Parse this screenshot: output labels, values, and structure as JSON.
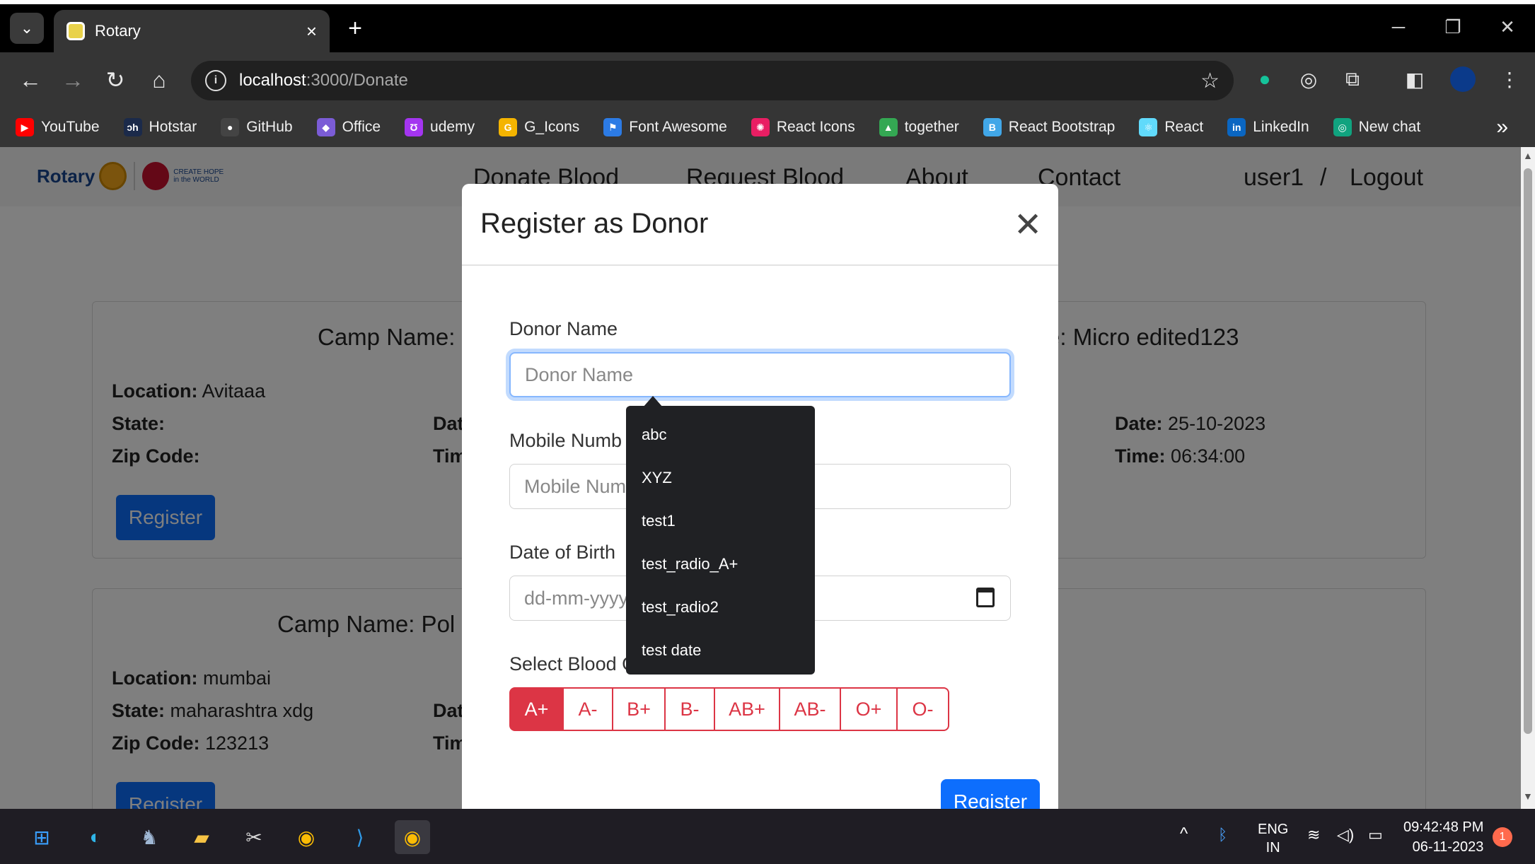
{
  "browser": {
    "tab_title": "Rotary",
    "url_host": "localhost",
    "url_path": ":3000/Donate",
    "bookmarks": [
      {
        "label": "YouTube",
        "color": "#ff0000",
        "glyph": "▶"
      },
      {
        "label": "Hotstar",
        "color": "#1b2a4a",
        "glyph": "ɔh"
      },
      {
        "label": "GitHub",
        "color": "#444444",
        "glyph": "●"
      },
      {
        "label": "Office",
        "color": "#7b5cd6",
        "glyph": "◆"
      },
      {
        "label": "udemy",
        "color": "#a435f0",
        "glyph": "Ʊ"
      },
      {
        "label": "G_Icons",
        "color": "#f4b400",
        "glyph": "G"
      },
      {
        "label": "Font Awesome",
        "color": "#2c7be5",
        "glyph": "⚑"
      },
      {
        "label": "React Icons",
        "color": "#e91e63",
        "glyph": "✺"
      },
      {
        "label": "together",
        "color": "#34a853",
        "glyph": "▲"
      },
      {
        "label": "React Bootstrap",
        "color": "#41a7e8",
        "glyph": "B"
      },
      {
        "label": "React",
        "color": "#61dafb",
        "glyph": "⚛"
      },
      {
        "label": "LinkedIn",
        "color": "#0a66c2",
        "glyph": "in"
      },
      {
        "label": "New chat",
        "color": "#10a37f",
        "glyph": "◎"
      }
    ],
    "more_bookmarks": "»"
  },
  "navbar": {
    "logo_text": "Rotary",
    "logo_tagline": "CREATE HOPE in the WORLD",
    "links": [
      "Donate Blood",
      "Request Blood",
      "About",
      "Contact"
    ],
    "user": "user1",
    "separator": "/",
    "logout": "Logout"
  },
  "camps": [
    {
      "title_left": "Camp Name:",
      "title_right": "e: Micro edited123",
      "location_label": "Location:",
      "location": "Avitaaa",
      "state_label": "State:",
      "state": "",
      "zip_label": "Zip Code:",
      "zip": "",
      "date_left_label": "Dat",
      "time_left_label": "Tim",
      "date_label": "Date:",
      "date": "25-10-2023",
      "time_label": "Time:",
      "time": "06:34:00",
      "register": "Register"
    },
    {
      "title_left": "Camp Name: Pol",
      "location_label": "Location:",
      "location": "mumbai",
      "state_label": "State:",
      "state": "maharashtra xdg",
      "zip_label": "Zip Code:",
      "zip": "123213",
      "date_left_label": "Dat",
      "time_left_label": "Tim",
      "register": "Register"
    }
  ],
  "modal": {
    "title": "Register as Donor",
    "close": "✕",
    "donor_name_label": "Donor Name",
    "donor_name_placeholder": "Donor Name",
    "mobile_label": "Mobile Numb",
    "mobile_placeholder": "Mobile Num",
    "dob_label": "Date of Birth",
    "dob_placeholder": "dd-mm-yyyy",
    "blood_label": "Select Blood G",
    "blood_groups": [
      "A+",
      "A-",
      "B+",
      "B-",
      "AB+",
      "AB-",
      "O+",
      "O-"
    ],
    "selected_blood_group": "A+",
    "register": "Register"
  },
  "autocomplete": [
    "abc",
    "XYZ",
    "test1",
    "test_radio_A+",
    "test_radio2",
    "test date"
  ],
  "taskbar": {
    "lang_top": "ENG",
    "lang_bottom": "IN",
    "time": "09:42:48 PM",
    "date": "06-11-2023",
    "notification_count": "1"
  }
}
